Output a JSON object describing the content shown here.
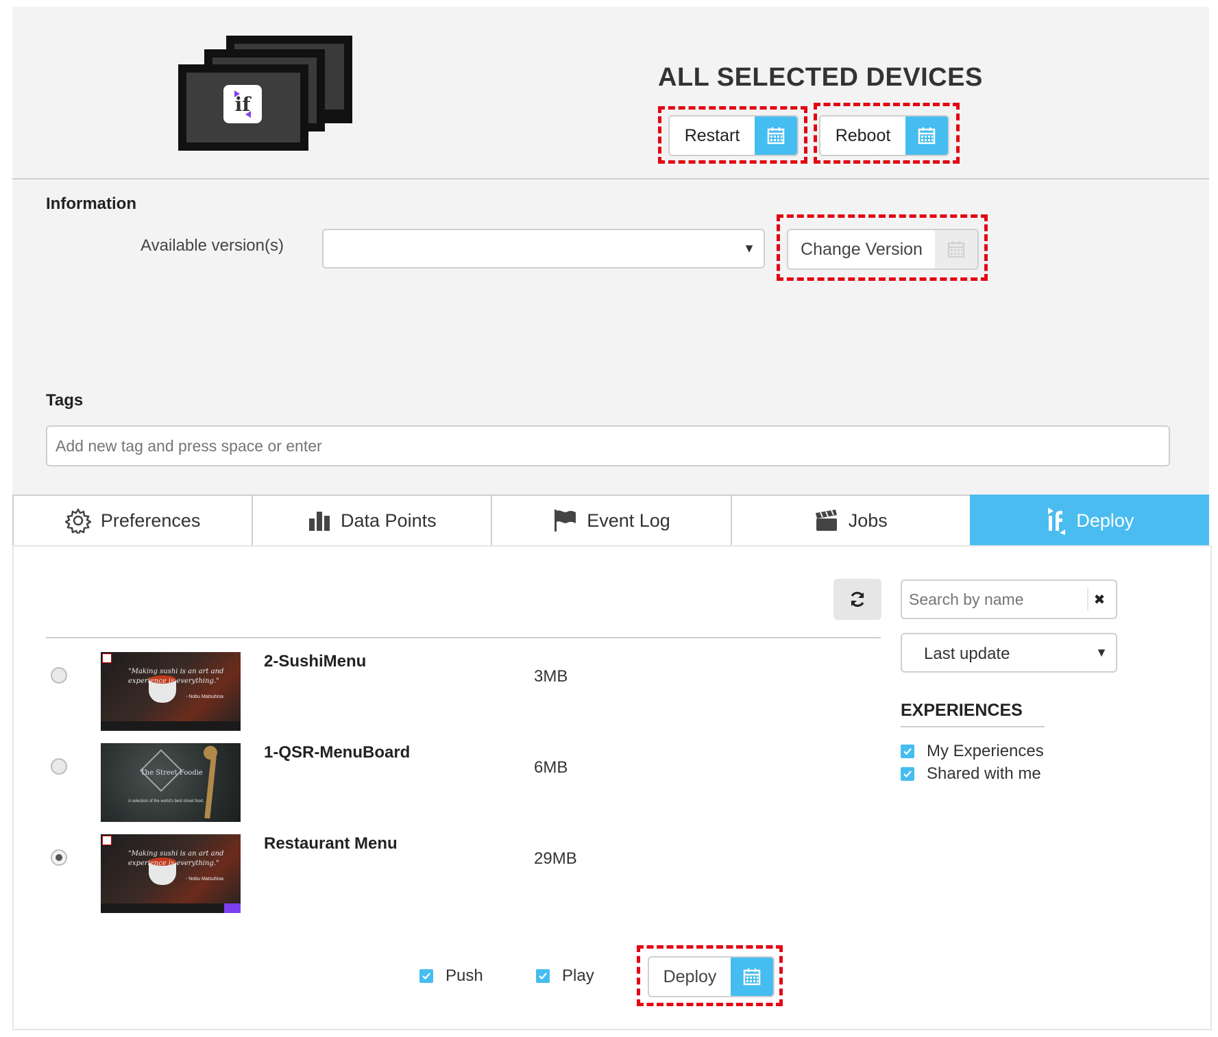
{
  "header": {
    "title": "ALL SELECTED DEVICES",
    "logo_text": "if",
    "restart_label": "Restart",
    "reboot_label": "Reboot"
  },
  "information": {
    "section_label": "Information",
    "available_versions_label": "Available version(s)",
    "available_versions_value": "",
    "change_version_label": "Change Version"
  },
  "tags": {
    "section_label": "Tags",
    "placeholder": "Add new tag and press space or enter"
  },
  "tabs": [
    {
      "label": "Preferences",
      "icon": "gear-icon"
    },
    {
      "label": "Data Points",
      "icon": "bar-chart-icon"
    },
    {
      "label": "Event Log",
      "icon": "flag-icon"
    },
    {
      "label": "Jobs",
      "icon": "clapperboard-icon"
    },
    {
      "label": "Deploy",
      "icon": "if-logo-icon",
      "active": true
    }
  ],
  "deploy": {
    "search_placeholder": "Search by name",
    "sort_selected": "Last update",
    "experiences_title": "EXPERIENCES",
    "filters": [
      {
        "label": "My Experiences",
        "checked": true
      },
      {
        "label": "Shared with me",
        "checked": true
      }
    ],
    "items": [
      {
        "name": "2-SushiMenu",
        "size": "3MB",
        "selected": false,
        "thumb_text": "\"Making sushi is an art and experience is everything.\"",
        "thumb_author": "- Nobu Matsuhisa"
      },
      {
        "name": "1-QSR-MenuBoard",
        "size": "6MB",
        "selected": false,
        "thumb_text": "The Street Foodie",
        "thumb_author": "A selection of the world's best street food."
      },
      {
        "name": "Restaurant Menu",
        "size": "29MB",
        "selected": true,
        "thumb_text": "\"Making sushi is an art and experience is everything.\"",
        "thumb_author": "- Nobu Matsuhisa"
      }
    ],
    "push_label": "Push",
    "push_checked": true,
    "play_label": "Play",
    "play_checked": true,
    "deploy_label": "Deploy"
  },
  "colors": {
    "accent": "#46bdf0",
    "highlight_dashed": "#e30613",
    "panel_bg": "#f3f3f3"
  }
}
